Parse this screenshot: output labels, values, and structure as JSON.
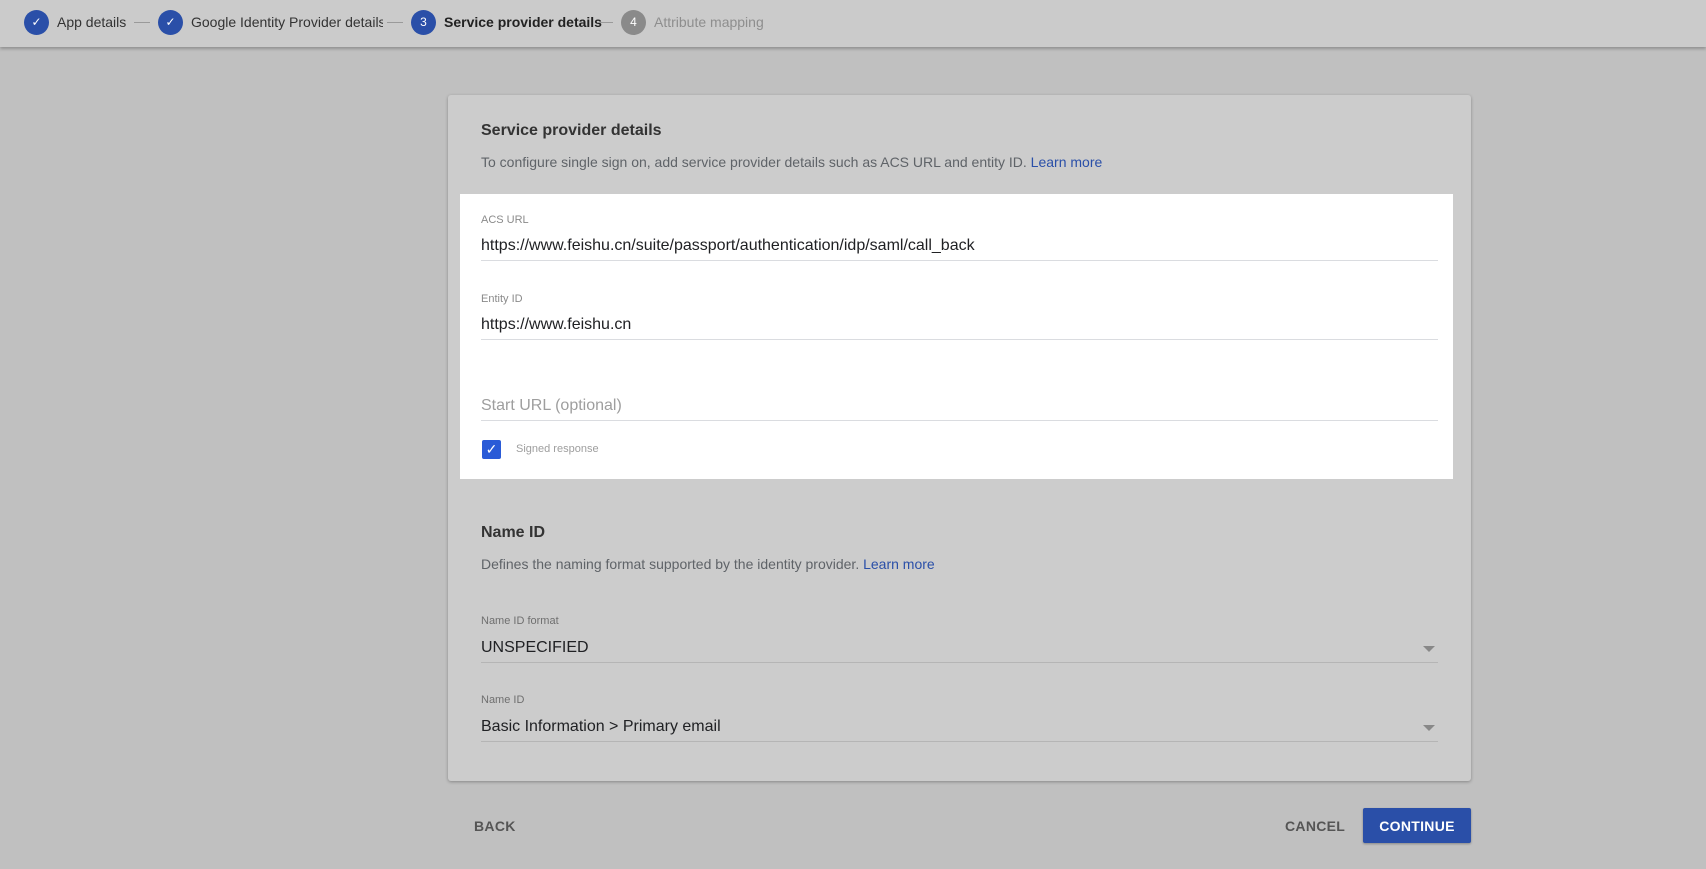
{
  "stepper": [
    {
      "label": "App details",
      "state": "done",
      "icon": "check-icon"
    },
    {
      "label": "Google Identity Provider details",
      "state": "done",
      "icon": "check-icon"
    },
    {
      "label": "Service provider details",
      "state": "active",
      "number": "3"
    },
    {
      "label": "Attribute mapping",
      "state": "pending",
      "number": "4"
    }
  ],
  "sp": {
    "title": "Service provider details",
    "description": "To configure single sign on, add service provider details such as ACS URL and entity ID.",
    "learn_more": "Learn more",
    "acs_label": "ACS URL",
    "acs_value": "https://www.feishu.cn/suite/passport/authentication/idp/saml/call_back",
    "entity_label": "Entity ID",
    "entity_value": "https://www.feishu.cn",
    "start_url_placeholder": "Start URL (optional)",
    "signed_label": "Signed response",
    "signed_checked": true
  },
  "nameid": {
    "title": "Name ID",
    "description": "Defines the naming format supported by the identity provider.",
    "learn_more": "Learn more",
    "format_label": "Name ID format",
    "format_value": "UNSPECIFIED",
    "nameid_label": "Name ID",
    "nameid_value": "Basic Information > Primary email"
  },
  "actions": {
    "back": "BACK",
    "cancel": "CANCEL",
    "continue": "CONTINUE"
  },
  "colors": {
    "primary": "#2a4fa8"
  }
}
